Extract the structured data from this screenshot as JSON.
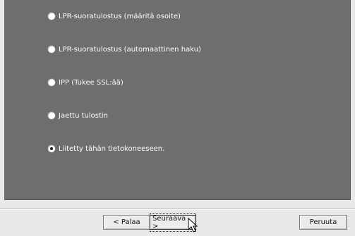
{
  "options": [
    {
      "label": "LPR-suoratulostus (määritä osoite)",
      "selected": false
    },
    {
      "label": "LPR-suoratulostus (automaattinen haku)",
      "selected": false
    },
    {
      "label": "IPP (Tukee SSL:ää)",
      "selected": false
    },
    {
      "label": "Jaettu tulostin",
      "selected": false
    },
    {
      "label": "Liitetty tähän tietokoneeseen.",
      "selected": true
    }
  ],
  "buttons": {
    "back_label": "< Palaa",
    "next_label": "Seuraava >",
    "cancel_label": "Peruuta"
  },
  "colors": {
    "panel_bg": "#6e6e6e",
    "footer_bg": "#e9e9e9",
    "option_text": "#ffffff"
  },
  "icons": {
    "cursor": "mouse-pointer-icon"
  }
}
